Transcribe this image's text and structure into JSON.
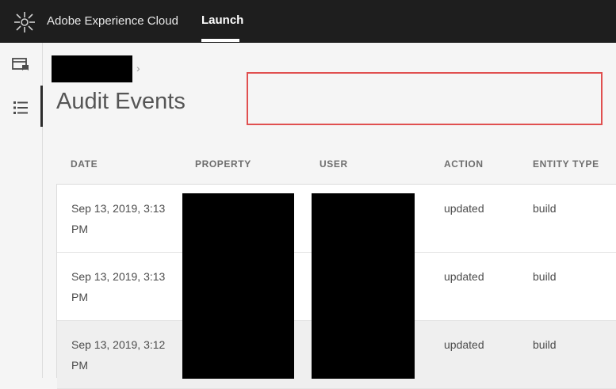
{
  "header": {
    "brand": "Adobe Experience Cloud",
    "active_tab": "Launch",
    "logo_icon": "adobe-experience-cloud-logo-icon"
  },
  "sidebar": {
    "items": [
      {
        "icon": "properties-icon"
      },
      {
        "icon": "list-icon",
        "active": true
      }
    ]
  },
  "breadcrumb": {
    "separator": "›"
  },
  "page": {
    "title": "Audit Events"
  },
  "table": {
    "columns": [
      "DATE",
      "PROPERTY",
      "USER",
      "ACTION",
      "ENTITY TYPE"
    ],
    "rows": [
      {
        "date_line1": "Sep 13, 2019, 3:13",
        "date_line2": "PM",
        "action": "updated",
        "entity_type": "build"
      },
      {
        "date_line1": "Sep 13, 2019, 3:13",
        "date_line2": "PM",
        "action": "updated",
        "entity_type": "build"
      },
      {
        "date_line1": "Sep 13, 2019, 3:12",
        "date_line2": "PM",
        "action": "updated",
        "entity_type": "build"
      }
    ]
  },
  "colors": {
    "topbar": "#1e1e1e",
    "annotation": "#e05050"
  }
}
